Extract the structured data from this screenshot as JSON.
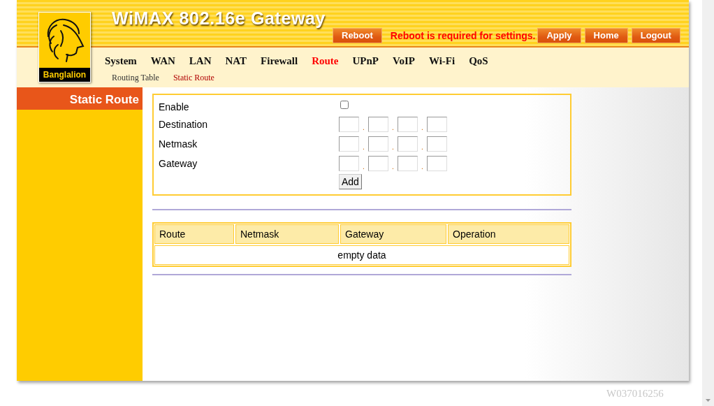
{
  "header": {
    "title": "WiMAX 802.16e Gateway",
    "logo_text": "Banglalion",
    "reboot_button": "Reboot",
    "notice": "Reboot is required for settings.",
    "buttons": [
      "Apply",
      "Home",
      "Logout"
    ]
  },
  "menu": [
    {
      "label": "System",
      "selected": false
    },
    {
      "label": "WAN",
      "selected": false
    },
    {
      "label": "LAN",
      "selected": false
    },
    {
      "label": "NAT",
      "selected": false
    },
    {
      "label": "Firewall",
      "selected": false
    },
    {
      "label": "Route",
      "selected": true
    },
    {
      "label": "UPnP",
      "selected": false
    },
    {
      "label": "VoIP",
      "selected": false
    },
    {
      "label": "Wi-Fi",
      "selected": false
    },
    {
      "label": "QoS",
      "selected": false
    }
  ],
  "submenu": [
    {
      "label": "Routing Table",
      "selected": false
    },
    {
      "label": "Static Route",
      "selected": true
    }
  ],
  "sidebar": {
    "title": "Static Route"
  },
  "form": {
    "enable": {
      "label": "Enable",
      "checked": false
    },
    "ip_rows": [
      {
        "label": "Destination",
        "separators": [
          ".",
          ".",
          "."
        ]
      },
      {
        "label": "Netmask",
        "separators": [
          ".",
          ".",
          "."
        ]
      },
      {
        "label": "Gateway",
        "separators": [
          ".",
          ".",
          "."
        ]
      }
    ],
    "add_button": "Add"
  },
  "table": {
    "columns": [
      "Route",
      "Netmask",
      "Gateway",
      "Operation"
    ],
    "empty_message": "empty data"
  },
  "footer": "W037016256"
}
